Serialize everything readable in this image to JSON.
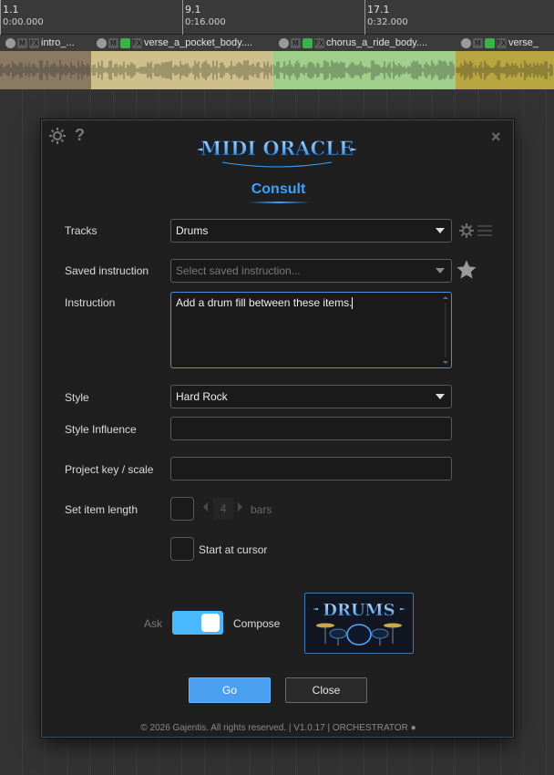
{
  "ruler": {
    "marks": [
      {
        "bar": "1.1",
        "time": "0:00.000"
      },
      {
        "bar": "9.1",
        "time": "0:16.000"
      },
      {
        "bar": "17.1",
        "time": "0:32.000"
      }
    ]
  },
  "items": [
    {
      "name": "intro_...",
      "color": "#8b7a63"
    },
    {
      "name": "verse_a_pocket_body....",
      "color": "#cfc08b"
    },
    {
      "name": "chorus_a_ride_body....",
      "color": "#9fcf8a"
    },
    {
      "name": "verse_",
      "color": "#b8a640"
    }
  ],
  "item_buttons": {
    "mute": "M",
    "fx": "FX"
  },
  "dialog": {
    "help_symbol": "?",
    "close_symbol": "×",
    "logo_text": "MIDI ORACLE",
    "title": "Consult",
    "tracks": {
      "label": "Tracks",
      "value": "Drums"
    },
    "saved_instruction": {
      "label": "Saved instruction",
      "placeholder": "Select saved instruction..."
    },
    "instruction": {
      "label": "Instruction",
      "value": "Add a drum fill between these items."
    },
    "style": {
      "label": "Style",
      "value": "Hard Rock"
    },
    "style_influence": {
      "label": "Style Influence",
      "value": ""
    },
    "project_key": {
      "label": "Project key / scale",
      "value": ""
    },
    "item_length": {
      "label": "Set item length",
      "value": "4",
      "unit": "bars"
    },
    "start_at_cursor": {
      "label": "Start at cursor"
    },
    "mode": {
      "left": "Ask",
      "right": "Compose",
      "selected": "Compose"
    },
    "drums_logo_text": "DRUMS",
    "go_label": "Go",
    "close_label": "Close",
    "footer": "© 2026 Gajentis. All rights reserved.  |  V1.0.17  |  ORCHESTRATOR ●"
  },
  "colors": {
    "accent": "#3ea0ff",
    "go": "#4a9ff0",
    "toggle": "#49b8ff"
  }
}
